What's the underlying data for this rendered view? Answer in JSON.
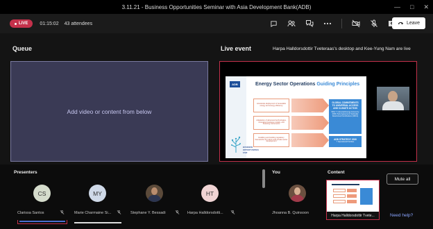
{
  "window": {
    "title": "3.11.21 - Business Opportunities Seminar with Asia Development Bank(ADB)"
  },
  "toolbar": {
    "live_label": "LIVE",
    "elapsed_time": "01:15:02",
    "attendees": "43 attendees",
    "icons": [
      "chat-icon",
      "people-icon",
      "qa-icon",
      "more-icon",
      "camera-off-icon",
      "mic-off-icon",
      "share-icon"
    ],
    "leave_label": "Leave"
  },
  "queue": {
    "label": "Queue",
    "placeholder": "Add video or content from below"
  },
  "live_event": {
    "label": "Live event",
    "description": "Harpa Halldorsdottir Tveteraas's desktop and Kee-Yung Nam are live"
  },
  "slide": {
    "logo": "ADB",
    "title_prefix": "Energy Sector Operations ",
    "title_highlight": "Guiding Principles",
    "items": [
      "Accelerate deployment of renewable energy and energy efficiency",
      "Adaptation of advanced technologies, innovative business models, and financing instruments",
      "Enabling and building regulatory frameworks for reform and private sector development"
    ],
    "box_main": "GLOBAL COMMITMENTS TO UNIVERSAL ACCESS AND CLIMATE ACTION",
    "box_main_sub": "SDG 7: Universal Energy Access by 2030; Paris Agreement: Nationally Determined Contributions (NDCs)",
    "box_strategy": "ADB STRATEGY 2030",
    "box_strategy_sub": "7 Operational Priorities",
    "footer_logo": "BUSINESS OPPORTUNITIES FAIR"
  },
  "presenters": {
    "label": "Presenters",
    "items": [
      {
        "initials": "CS",
        "name": "Clarissa Santos",
        "avatar_color": "#d5dccc"
      },
      {
        "initials": "MY",
        "name": "Marie Charmaine Si...",
        "avatar_color": "#cfd9e8"
      },
      {
        "initials": "",
        "name": "Stephane Y. Bessadi",
        "avatar_color": "#5b4a3a"
      },
      {
        "initials": "HT",
        "name": "Harpa Halldorsdotti...",
        "avatar_color": "#f0d4d4"
      }
    ]
  },
  "you": {
    "label": "You",
    "name": "Jhoanna B. Quinsoon"
  },
  "content": {
    "label": "Content",
    "thumb_caption": "Harpa Halldorsdottir Tvete..."
  },
  "actions": {
    "mute_all": "Mute all",
    "need_help": "Need help?"
  },
  "colors": {
    "live_red": "#c4314b",
    "accent_blue": "#3a8ad6",
    "queue_bg": "#3a3a55"
  }
}
